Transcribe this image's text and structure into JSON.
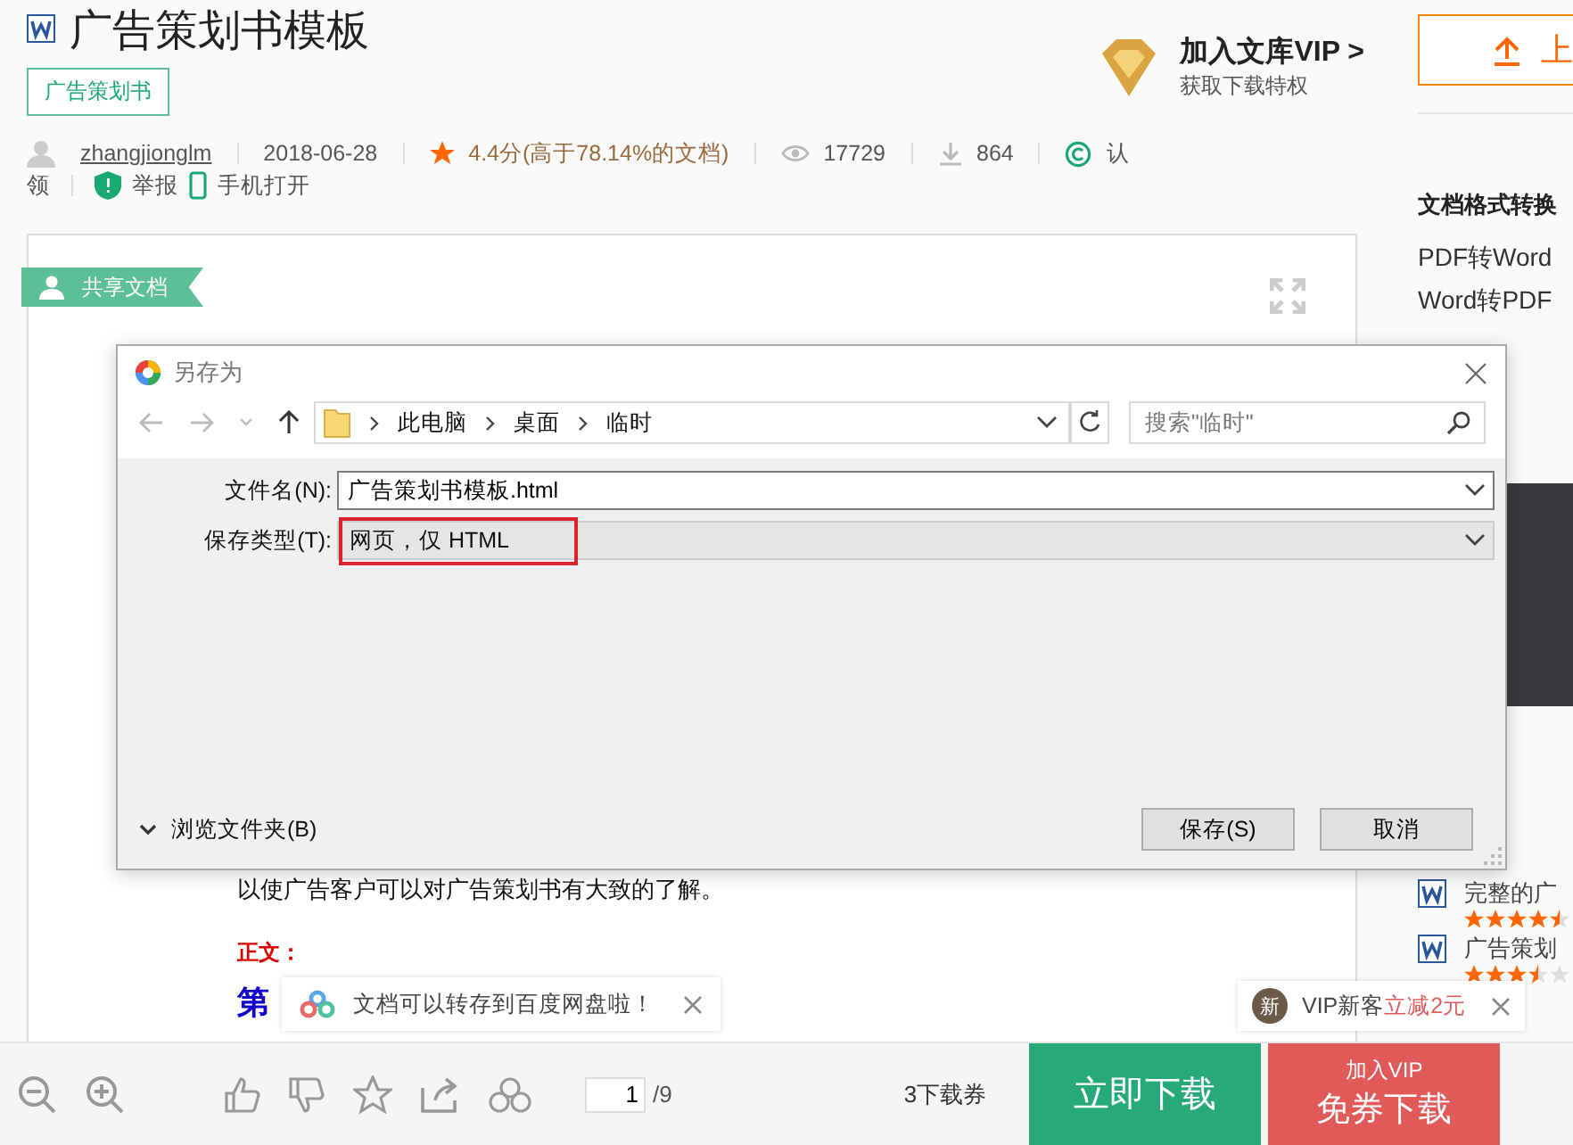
{
  "header": {
    "title": "广告策划书模板",
    "tag": "广告策划书",
    "vip": {
      "title": "加入文库VIP >",
      "subtitle": "获取下载特权"
    },
    "upload_button": "上"
  },
  "meta": {
    "author": "zhangjionglm",
    "date": "2018-06-28",
    "rating": "4.4分(高于78.14%的文档)",
    "views": "17729",
    "downloads": "864",
    "cert": "认",
    "claim": "领",
    "report": "举报",
    "mobile": "手机打开"
  },
  "document": {
    "badge": "共享文档",
    "lines": [
      {
        "kind": "body",
        "text": "以使广告客户可以对广告策划书有大致的了解。"
      },
      {
        "kind": "label",
        "text": "正文："
      },
      {
        "kind": "heading",
        "text": "第"
      }
    ]
  },
  "sidebar": {
    "title": "文档格式转换",
    "links": [
      "PDF转Word",
      "Word转PDF"
    ],
    "recommendations": [
      {
        "kind": "doc",
        "title": "完整的广",
        "stars": 4.5
      },
      {
        "kind": "doc",
        "title": "广告策划",
        "stars": 3.5
      }
    ]
  },
  "dialog": {
    "title": "另存为",
    "path": [
      "此电脑",
      "桌面",
      "临时"
    ],
    "search": {
      "placeholder": "搜索\"临时\""
    },
    "filename": {
      "label": "文件名(N):",
      "value": "广告策划书模板.html"
    },
    "filetype": {
      "label": "保存类型(T):",
      "value": "网页，仅 HTML",
      "highlighted": true
    },
    "browse": "浏览文件夹(B)",
    "buttons": [
      "保存(S)",
      "取消"
    ]
  },
  "toasts": {
    "netdisk": "文档可以转存到百度网盘啦！",
    "vip": {
      "badge": "新",
      "text": "VIP新客",
      "highlight": "立减2元"
    }
  },
  "toolbar": {
    "page": "1",
    "total": "/9",
    "coupons": "3下载券",
    "download": "立即下载",
    "vip_top": "加入VIP",
    "vip_bottom": "免券下载"
  }
}
